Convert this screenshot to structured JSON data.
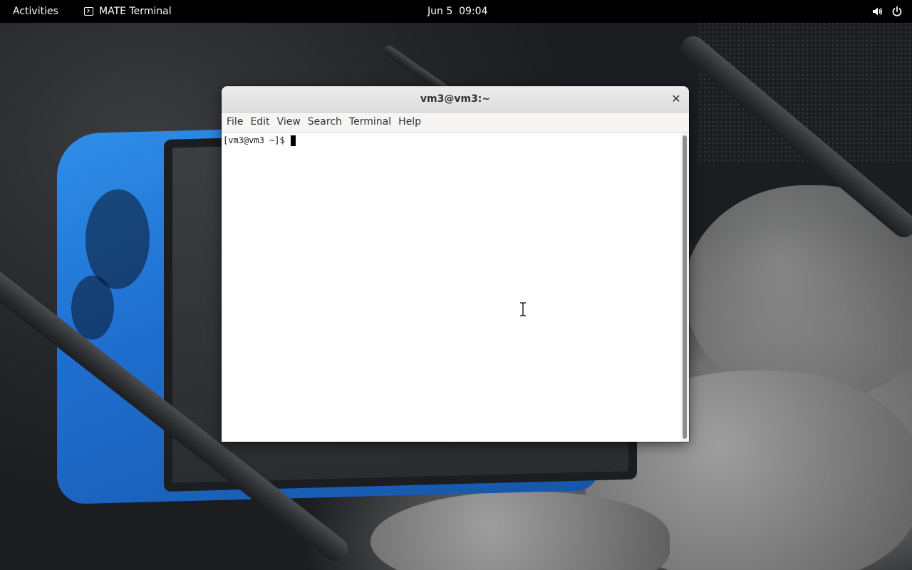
{
  "topbar": {
    "activities_label": "Activities",
    "app_name": "MATE Terminal",
    "app_icon": "terminal-icon",
    "clock": "Jun 5  09:04",
    "tray_icons": [
      "volume-icon",
      "power-icon"
    ]
  },
  "window": {
    "title": "vm3@vm3:~",
    "close_icon": "close-icon",
    "menu": [
      "File",
      "Edit",
      "View",
      "Search",
      "Terminal",
      "Help"
    ]
  },
  "terminal": {
    "prompt": "[vm3@vm3 ~]$ ",
    "input": ""
  },
  "colors": {
    "topbar_bg": "#000000",
    "terminal_bg": "#ffffff",
    "terminal_fg": "#1a1a1a",
    "wallpaper_accent": "#1f6fd0"
  }
}
